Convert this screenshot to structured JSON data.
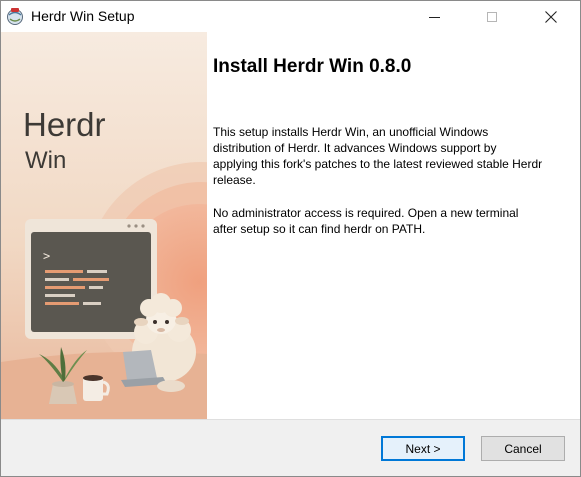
{
  "window": {
    "title": "Herdr Win Setup",
    "icon": "setup-app-icon",
    "controls": [
      "minimize-icon",
      "maximize-icon",
      "close-icon"
    ]
  },
  "art": {
    "logo_line1": "Herdr",
    "logo_line2": "Win",
    "illustration": "sheep-with-laptop-and-terminal",
    "terminal_prompt": ">"
  },
  "main": {
    "heading": "Install Herdr Win 0.8.0",
    "paragraph1": "This setup installs Herdr Win, an unofficial Windows distribution of Herdr. It advances Windows support by applying this fork's patches to the latest reviewed stable Herdr release.",
    "paragraph2": "No administrator access is required. Open a new terminal after setup so it can find herdr on PATH."
  },
  "footer": {
    "next_label": "Next >",
    "cancel_label": "Cancel"
  },
  "colors": {
    "accent": "#0078d7",
    "art_background": "#f3e0cf",
    "art_orange": "#e9a584",
    "logo_text": "#3d3a36"
  }
}
